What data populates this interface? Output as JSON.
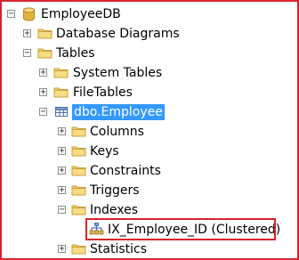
{
  "tree": {
    "root": {
      "label": "EmployeeDB",
      "toggle": "−",
      "icon": "database-icon"
    },
    "database_diagrams": {
      "label": "Database Diagrams",
      "toggle": "+",
      "icon": "folder-icon"
    },
    "tables": {
      "label": "Tables",
      "toggle": "−",
      "icon": "folder-icon"
    },
    "system_tables": {
      "label": "System Tables",
      "toggle": "+",
      "icon": "folder-icon"
    },
    "file_tables": {
      "label": "FileTables",
      "toggle": "+",
      "icon": "folder-icon"
    },
    "employee_table": {
      "label": "dbo.Employee",
      "toggle": "−",
      "icon": "table-icon",
      "selected": true
    },
    "columns": {
      "label": "Columns",
      "toggle": "+",
      "icon": "folder-icon"
    },
    "keys": {
      "label": "Keys",
      "toggle": "+",
      "icon": "folder-icon"
    },
    "constraints": {
      "label": "Constraints",
      "toggle": "+",
      "icon": "folder-icon"
    },
    "triggers": {
      "label": "Triggers",
      "toggle": "+",
      "icon": "folder-icon"
    },
    "indexes": {
      "label": "Indexes",
      "toggle": "−",
      "icon": "folder-icon"
    },
    "index_item": {
      "label": "IX_Employee_ID (Clustered)",
      "icon": "index-icon"
    },
    "statistics": {
      "label": "Statistics",
      "toggle": "+",
      "icon": "folder-icon"
    }
  },
  "colors": {
    "highlight_border": "#d9232e",
    "selection": "#3399ff",
    "folder": "#e8c25a",
    "database": "#d4a12a"
  }
}
